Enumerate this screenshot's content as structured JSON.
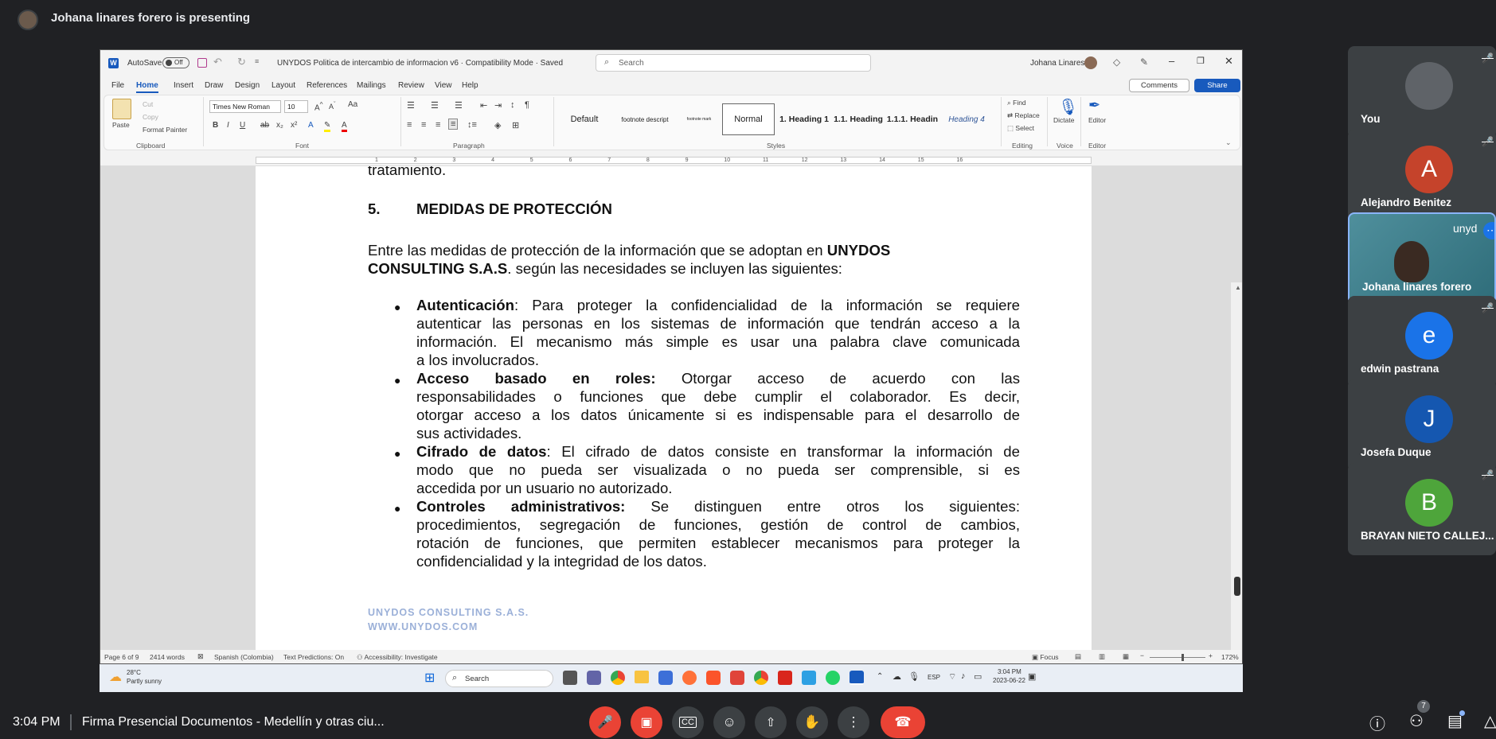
{
  "meet": {
    "presenting_text": "Johana linares forero is presenting",
    "time": "3:04 PM",
    "meeting_title": "Firma Presencial Documentos - Medellín y otras ciu...",
    "people_count": "7",
    "participants": [
      {
        "name": "You",
        "initial": "",
        "color": "#5f6368",
        "muted": true
      },
      {
        "name": "Alejandro Benitez",
        "initial": "A",
        "color": "#c5432b",
        "muted": true
      },
      {
        "name": "Johana linares forero",
        "initial": "",
        "color": "#5a8fa0",
        "muted": false,
        "overlay_text": "unyd"
      },
      {
        "name": "edwin pastrana",
        "initial": "e",
        "color": "#1a73e8",
        "muted": true
      },
      {
        "name": "Josefa Duque",
        "initial": "J",
        "color": "#1557b0",
        "muted": false
      },
      {
        "name": "BRAYAN NIETO CALLEJ...",
        "initial": "B",
        "color": "#4ea53b",
        "muted": true
      }
    ]
  },
  "word": {
    "autosave": "AutoSave",
    "autosave_state": "Off",
    "doc_title": "UNYDOS Politica de intercambio de informacion v6  ·  Compatibility Mode  ·  Saved",
    "search_placeholder": "Search",
    "user": "Johana Linares",
    "tabs": [
      "File",
      "Home",
      "Insert",
      "Draw",
      "Design",
      "Layout",
      "References",
      "Mailings",
      "Review",
      "View",
      "Help"
    ],
    "comments": "Comments",
    "share": "Share",
    "clipboard": {
      "paste": "Paste",
      "cut": "Cut",
      "copy": "Copy",
      "format_painter": "Format Painter",
      "label": "Clipboard"
    },
    "font": {
      "name": "Times New Roman",
      "size": "10",
      "label": "Font"
    },
    "paragraph_label": "Paragraph",
    "styles": [
      "Default",
      "footnote descript",
      "footnote mark",
      "Normal",
      "1.  Heading 1",
      "1.1.  Heading",
      "1.1.1.  Headin",
      "Heading 4"
    ],
    "styles_label": "Styles",
    "editing": {
      "find": "Find",
      "replace": "Replace",
      "select": "Select",
      "label": "Editing"
    },
    "voice": {
      "dictate": "Dictate",
      "label": "Voice"
    },
    "editor": {
      "editor": "Editor",
      "label": "Editor"
    },
    "ruler_numbers": [
      "1",
      "2",
      "3",
      "4",
      "5",
      "6",
      "7",
      "8",
      "9",
      "10",
      "11",
      "12",
      "13",
      "14",
      "15",
      "16"
    ],
    "status": {
      "page": "Page 6 of 9",
      "words": "2414 words",
      "language": "Spanish (Colombia)",
      "predictions": "Text Predictions: On",
      "accessibility": "Accessibility: Investigate",
      "focus": "Focus",
      "zoom": "172%"
    }
  },
  "document": {
    "prev_word": "tratamiento.",
    "heading_num": "5.",
    "heading": "MEDIDAS DE PROTECCIÓN",
    "intro_1": "Entre las medidas de protección de la información que se adoptan en ",
    "intro_bold": "UNYDOS",
    "intro_bold_2": "CONSULTING S.A.S",
    "intro_2": ". según las necesidades se incluyen las siguientes:",
    "bullets": [
      {
        "title": "Autenticación",
        "lines": [
          ": Para proteger la confidencialidad de la información se requiere",
          "autenticar las personas en los sistemas de información que tendrán acceso a la",
          "información. El mecanismo más simple es usar una palabra clave comunicada",
          "a los involucrados."
        ]
      },
      {
        "title": "Acceso basado en roles:",
        "lines": [
          " Otorgar acceso de acuerdo con las",
          "responsabilidades o funciones que debe cumplir el colaborador. Es decir,",
          "otorgar acceso a los datos únicamente si es indispensable para el desarrollo de",
          "sus actividades."
        ]
      },
      {
        "title": "Cifrado de datos",
        "lines": [
          ": El cifrado de datos consiste en transformar la información de",
          "modo que no pueda ser visualizada o no pueda ser comprensible, si es",
          "accedida por un usuario no autorizado."
        ]
      },
      {
        "title": "Controles administrativos:",
        "lines": [
          " Se distinguen entre otros los siguientes:",
          "procedimientos, segregación de funciones, gestión de control de cambios,",
          "rotación de funciones, que permiten establecer mecanismos para proteger la",
          "confidencialidad y la integridad de los datos."
        ]
      }
    ],
    "footer_1": "UNYDOS CONSULTING S.A.S.",
    "footer_2": "WWW.UNYDOS.COM"
  },
  "taskbar": {
    "weather_temp": "28°C",
    "weather_desc": "Partly sunny",
    "search": "Search",
    "lang": "ESP",
    "time": "3:04 PM",
    "date": "2023-06-22"
  }
}
